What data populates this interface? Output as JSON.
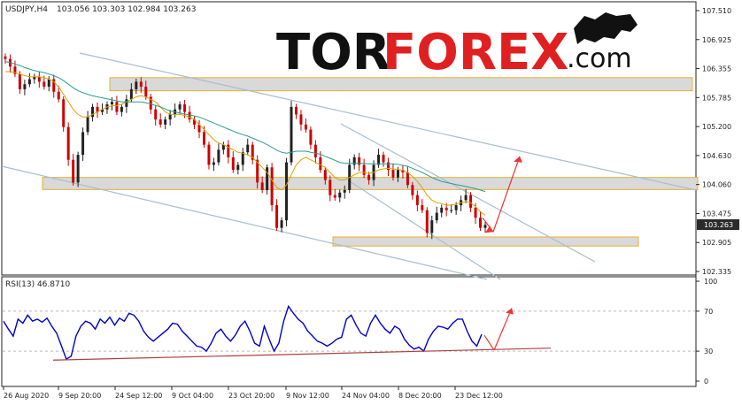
{
  "header": {
    "symbol": "USDJPY,H4",
    "ohlc": "103.056 103.303 102.984 103.263"
  },
  "logo": {
    "part1": "TOR",
    "part2": "FOREX",
    "part3": ".com"
  },
  "price_axis": {
    "ticks": [
      "107.510",
      "106.925",
      "106.355",
      "105.785",
      "105.200",
      "104.630",
      "104.060",
      "103.475",
      "102.905",
      "102.335"
    ],
    "current_price": "103.263",
    "ylim": [
      102.335,
      107.51
    ]
  },
  "rsi": {
    "label": "RSI(13) 46.8710",
    "ticks": [
      "100",
      "70",
      "30",
      "0"
    ],
    "ylim": [
      0,
      100
    ]
  },
  "time_axis": {
    "ticks": [
      "26 Aug 2020",
      "9 Sep 20:00",
      "24 Sep 12:00",
      "9 Oct 04:00",
      "23 Oct 20:00",
      "9 Nov 12:00",
      "24 Nov 04:00",
      "8 Dec 20:00",
      "23 Dec 12:00"
    ]
  },
  "colors": {
    "bull": "#222222",
    "bear": "#cc0000",
    "ma_fast": "#e0a000",
    "ma_slow": "#2a9d8f",
    "channel": "#a8bed0",
    "zone_fill": "#d9d9d9",
    "zone_border": "#e8b030",
    "rsi_line": "#0000cc",
    "arrow": "#ee3333",
    "support": "#b04040"
  },
  "chart_data": {
    "type": "candlestick",
    "close_path": [
      106.55,
      106.4,
      106.25,
      105.95,
      106.05,
      106.15,
      106.2,
      106.1,
      106.0,
      106.15,
      105.9,
      105.75,
      105.2,
      104.55,
      104.1,
      104.65,
      105.1,
      105.4,
      105.6,
      105.5,
      105.55,
      105.65,
      105.7,
      105.5,
      105.6,
      105.75,
      105.95,
      106.1,
      106.0,
      105.8,
      105.55,
      105.35,
      105.25,
      105.35,
      105.45,
      105.55,
      105.65,
      105.5,
      105.35,
      105.25,
      105.1,
      104.85,
      104.45,
      104.5,
      104.75,
      104.85,
      104.6,
      104.35,
      104.45,
      104.7,
      104.85,
      104.55,
      104.1,
      103.95,
      104.4,
      103.65,
      103.2,
      103.35,
      104.5,
      105.6,
      105.45,
      105.25,
      105.15,
      104.85,
      104.6,
      104.35,
      104.15,
      103.85,
      103.8,
      103.9,
      103.95,
      104.45,
      104.6,
      104.45,
      104.25,
      104.15,
      104.45,
      104.65,
      104.5,
      104.35,
      104.2,
      104.35,
      104.3,
      104.05,
      103.85,
      103.65,
      103.55,
      103.1,
      103.35,
      103.5,
      103.6,
      103.55,
      103.55,
      103.65,
      103.75,
      103.85,
      103.6,
      103.4,
      103.2,
      103.26
    ],
    "ma_fast": [
      106.3,
      106.3,
      106.28,
      106.25,
      106.22,
      106.2,
      106.2,
      106.2,
      106.18,
      106.15,
      106.1,
      106.0,
      105.85,
      105.7,
      105.55,
      105.45,
      105.4,
      105.4,
      105.45,
      105.5,
      105.55,
      105.6,
      105.62,
      105.63,
      105.65,
      105.7,
      105.75,
      105.8,
      105.82,
      105.8,
      105.75,
      105.7,
      105.6,
      105.5,
      105.45,
      105.45,
      105.45,
      105.43,
      105.4,
      105.35,
      105.25,
      105.15,
      105.05,
      104.95,
      104.88,
      104.85,
      104.8,
      104.75,
      104.7,
      104.68,
      104.65,
      104.6,
      104.5,
      104.4,
      104.3,
      104.15,
      104.0,
      103.95,
      104.05,
      104.25,
      104.45,
      104.55,
      104.6,
      104.55,
      104.5,
      104.45,
      104.4,
      104.3,
      104.2,
      104.15,
      104.15,
      104.2,
      104.25,
      104.3,
      104.3,
      104.28,
      104.3,
      104.35,
      104.37,
      104.38,
      104.37,
      104.36,
      104.34,
      104.3,
      104.22,
      104.12,
      104.0,
      103.85,
      103.75,
      103.7,
      103.68,
      103.65,
      103.65,
      103.67,
      103.7,
      103.72,
      103.7,
      103.62,
      103.52,
      103.45
    ],
    "ma_slow": [
      106.5,
      106.48,
      106.45,
      106.42,
      106.38,
      106.35,
      106.32,
      106.3,
      106.28,
      106.25,
      106.22,
      106.18,
      106.12,
      106.05,
      105.98,
      105.92,
      105.88,
      105.85,
      105.82,
      105.8,
      105.78,
      105.76,
      105.74,
      105.72,
      105.7,
      105.7,
      105.7,
      105.7,
      105.7,
      105.68,
      105.66,
      105.63,
      105.6,
      105.56,
      105.52,
      105.5,
      105.48,
      105.46,
      105.44,
      105.42,
      105.4,
      105.36,
      105.32,
      105.28,
      105.24,
      105.2,
      105.16,
      105.12,
      105.08,
      105.05,
      105.02,
      104.98,
      104.94,
      104.9,
      104.85,
      104.8,
      104.74,
      104.7,
      104.68,
      104.7,
      104.72,
      104.72,
      104.72,
      104.7,
      104.68,
      104.66,
      104.62,
      104.58,
      104.54,
      104.5,
      104.48,
      104.48,
      104.48,
      104.48,
      104.48,
      104.47,
      104.47,
      104.47,
      104.47,
      104.47,
      104.47,
      104.46,
      104.44,
      104.42,
      104.38,
      104.34,
      104.3,
      104.25,
      104.2,
      104.16,
      104.12,
      104.1,
      104.08,
      104.06,
      104.04,
      104.02,
      104.0,
      103.98,
      103.95,
      103.92
    ],
    "rsi_values": [
      60,
      52,
      45,
      62,
      58,
      66,
      60,
      62,
      59,
      63,
      55,
      48,
      35,
      22,
      25,
      45,
      55,
      60,
      58,
      52,
      62,
      58,
      64,
      56,
      63,
      60,
      68,
      66,
      60,
      50,
      44,
      40,
      44,
      48,
      52,
      58,
      57,
      50,
      45,
      40,
      35,
      34,
      30,
      38,
      48,
      52,
      45,
      40,
      46,
      55,
      60,
      50,
      38,
      35,
      55,
      42,
      30,
      38,
      60,
      75,
      68,
      62,
      58,
      50,
      45,
      40,
      38,
      35,
      38,
      42,
      44,
      62,
      66,
      56,
      48,
      45,
      58,
      66,
      58,
      52,
      48,
      55,
      52,
      42,
      36,
      32,
      34,
      30,
      42,
      50,
      55,
      54,
      52,
      58,
      62,
      62,
      50,
      40,
      35,
      46.87
    ],
    "zones": [
      {
        "from": 105.92,
        "to": 106.18
      },
      {
        "from": 103.96,
        "to": 104.2
      },
      {
        "from": 102.84,
        "to": 103.02
      }
    ],
    "projection": {
      "start": 103.12,
      "target": 104.62
    },
    "rsi_projection": {
      "start": 31,
      "target": 73
    }
  }
}
